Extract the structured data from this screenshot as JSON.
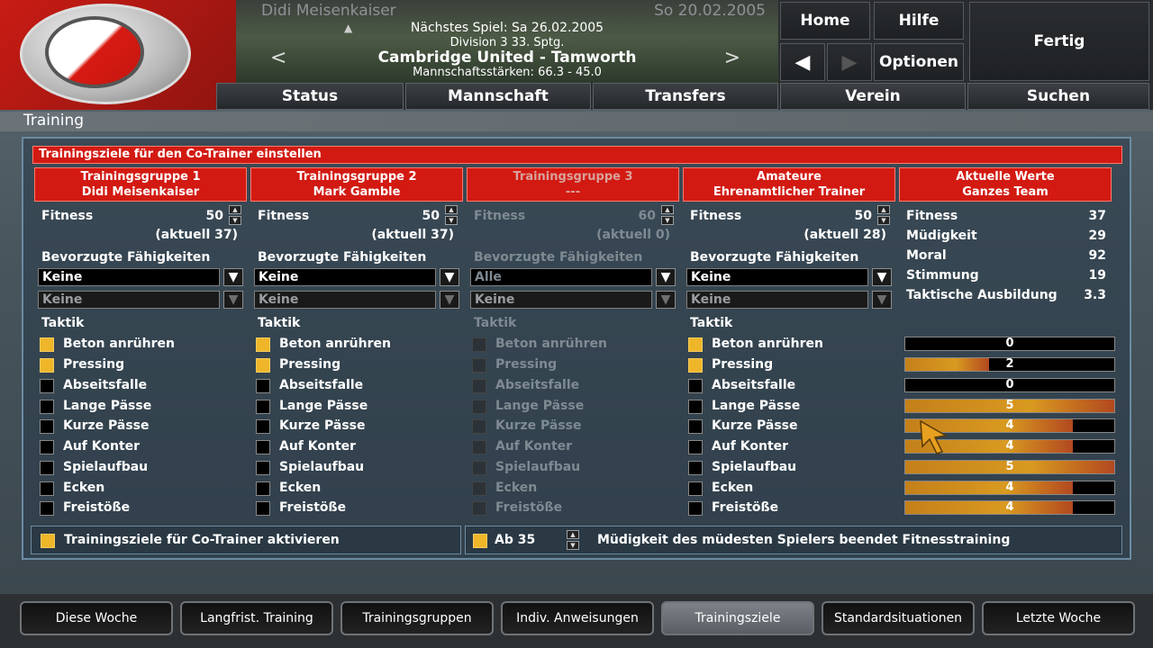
{
  "header": {
    "manager_name": "Didi Meisenkaiser",
    "date": "So 20.02.2005",
    "next_match": "Nächstes Spiel: Sa 26.02.2005",
    "division": "Division 3 33. Sptg.",
    "match": "Cambridge United - Tamworth",
    "strengths": "Mannschaftsstärken: 66.3 - 45.0"
  },
  "top_buttons": {
    "home": "Home",
    "help": "Hilfe",
    "done": "Fertig",
    "options": "Optionen"
  },
  "nav_tabs": [
    "Status",
    "Mannschaft",
    "Transfers",
    "Verein",
    "Suchen"
  ],
  "page_title": "Training",
  "panel_header": "Trainingsziele für den Co-Trainer einstellen",
  "columns": [
    {
      "title1": "Trainingsgruppe 1",
      "title2": "Didi Meisenkaiser",
      "fitness_label": "Fitness",
      "fitness_value": "50",
      "current": "(aktuell 37)",
      "skills_label": "Bevorzugte Fähigkeiten",
      "skill1": "Keine",
      "skill2": "Keine",
      "tactics_label": "Taktik",
      "tactics": [
        {
          "label": "Beton anrühren",
          "checked": true
        },
        {
          "label": "Pressing",
          "checked": true
        },
        {
          "label": "Abseitsfalle",
          "checked": false
        },
        {
          "label": "Lange Pässe",
          "checked": false
        },
        {
          "label": "Kurze Pässe",
          "checked": false
        },
        {
          "label": "Auf Konter",
          "checked": false
        },
        {
          "label": "Spielaufbau",
          "checked": false
        },
        {
          "label": "Ecken",
          "checked": false
        },
        {
          "label": "Freistöße",
          "checked": false
        }
      ]
    },
    {
      "title1": "Trainingsgruppe 2",
      "title2": "Mark Gamble",
      "fitness_label": "Fitness",
      "fitness_value": "50",
      "current": "(aktuell 37)",
      "skills_label": "Bevorzugte Fähigkeiten",
      "skill1": "Keine",
      "skill2": "Keine",
      "tactics_label": "Taktik",
      "tactics": [
        {
          "label": "Beton anrühren",
          "checked": true
        },
        {
          "label": "Pressing",
          "checked": true
        },
        {
          "label": "Abseitsfalle",
          "checked": false
        },
        {
          "label": "Lange Pässe",
          "checked": false
        },
        {
          "label": "Kurze Pässe",
          "checked": false
        },
        {
          "label": "Auf Konter",
          "checked": false
        },
        {
          "label": "Spielaufbau",
          "checked": false
        },
        {
          "label": "Ecken",
          "checked": false
        },
        {
          "label": "Freistöße",
          "checked": false
        }
      ]
    },
    {
      "title1": "Trainingsgruppe 3",
      "title2": "---",
      "fitness_label": "Fitness",
      "fitness_value": "60",
      "current": "(aktuell 0)",
      "skills_label": "Bevorzugte Fähigkeiten",
      "skill1": "Alle",
      "skill2": "Keine",
      "tactics_label": "Taktik",
      "tactics": [
        {
          "label": "Beton anrühren",
          "checked": false
        },
        {
          "label": "Pressing",
          "checked": false
        },
        {
          "label": "Abseitsfalle",
          "checked": false
        },
        {
          "label": "Lange Pässe",
          "checked": false
        },
        {
          "label": "Kurze Pässe",
          "checked": false
        },
        {
          "label": "Auf Konter",
          "checked": false
        },
        {
          "label": "Spielaufbau",
          "checked": false
        },
        {
          "label": "Ecken",
          "checked": false
        },
        {
          "label": "Freistöße",
          "checked": false
        }
      ]
    },
    {
      "title1": "Amateure",
      "title2": "Ehrenamtlicher Trainer",
      "fitness_label": "Fitness",
      "fitness_value": "50",
      "current": "(aktuell 28)",
      "skills_label": "Bevorzugte Fähigkeiten",
      "skill1": "Keine",
      "skill2": "Keine",
      "tactics_label": "Taktik",
      "tactics": [
        {
          "label": "Beton anrühren",
          "checked": true
        },
        {
          "label": "Pressing",
          "checked": true
        },
        {
          "label": "Abseitsfalle",
          "checked": false
        },
        {
          "label": "Lange Pässe",
          "checked": false
        },
        {
          "label": "Kurze Pässe",
          "checked": false
        },
        {
          "label": "Auf Konter",
          "checked": false
        },
        {
          "label": "Spielaufbau",
          "checked": false
        },
        {
          "label": "Ecken",
          "checked": false
        },
        {
          "label": "Freistöße",
          "checked": false
        }
      ]
    }
  ],
  "current_values": {
    "title1": "Aktuelle Werte",
    "title2": "Ganzes Team",
    "stats": [
      {
        "label": "Fitness",
        "value": "37"
      },
      {
        "label": "Müdigkeit",
        "value": "29"
      },
      {
        "label": "Moral",
        "value": "92"
      },
      {
        "label": "Stimmung",
        "value": "19"
      },
      {
        "label": "Taktische Ausbildung",
        "value": "3.3"
      }
    ],
    "tactic_levels": [
      {
        "value": "0",
        "fill": 0.0
      },
      {
        "value": "2",
        "fill": 0.4
      },
      {
        "value": "0",
        "fill": 0.0
      },
      {
        "value": "5",
        "fill": 1.0
      },
      {
        "value": "4",
        "fill": 0.8
      },
      {
        "value": "4",
        "fill": 0.8
      },
      {
        "value": "5",
        "fill": 1.0
      },
      {
        "value": "4",
        "fill": 0.8
      },
      {
        "value": "4",
        "fill": 0.8
      }
    ]
  },
  "footer": {
    "activate_label": "Trainingsziele für Co-Trainer aktivieren",
    "threshold_label": "Ab 35",
    "fatigue_label": "Müdigkeit des müdesten Spielers beendet Fitnesstraining"
  },
  "bottom_tabs": [
    "Diese Woche",
    "Langfrist. Training",
    "Trainingsgruppen",
    "Indiv. Anweisungen",
    "Trainingsziele",
    "Standardsituationen",
    "Letzte Woche"
  ],
  "active_bottom_tab": "Trainingsziele",
  "colors": {
    "accent_red": "#d21a12",
    "checkbox_on": "#f0b62a"
  }
}
